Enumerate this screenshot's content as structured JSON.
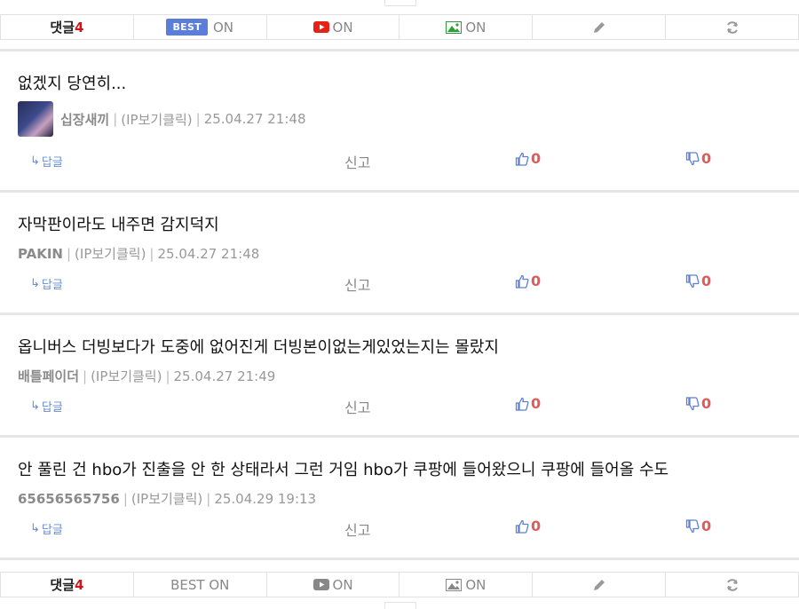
{
  "toolbar": {
    "comments_label": "댓글",
    "comments_count": "4",
    "best_badge": "BEST",
    "best_state": "ON",
    "youtube_state": "ON",
    "image_state": "ON",
    "icons": {
      "youtube": "youtube-icon",
      "image": "image-icon",
      "write": "pencil-icon",
      "refresh": "refresh-icon"
    },
    "colors": {
      "count": "#d0151a",
      "best_badge": "#5b7fd8",
      "youtube": "#e62117",
      "image": "#2e9e3a"
    }
  },
  "bottom_toolbar": {
    "comments_label": "댓글",
    "comments_count": "4",
    "best_text": "BEST ON",
    "youtube_state": "ON",
    "image_state": "ON"
  },
  "comments": [
    {
      "text": "없겠지 당연히...",
      "nick": "십장새끼",
      "ip": "(IP보기클릭)",
      "date": "25.04.27 21:48",
      "has_avatar": true,
      "reply": "답글",
      "report": "신고",
      "likes": "0",
      "dislikes": "0"
    },
    {
      "text": "자막판이라도 내주면 감지덕지",
      "nick": "PAKIN",
      "ip": "(IP보기클릭)",
      "date": "25.04.27 21:48",
      "has_avatar": false,
      "reply": "답글",
      "report": "신고",
      "likes": "0",
      "dislikes": "0"
    },
    {
      "text": "옵니버스 더빙보다가 도중에 없어진게 더빙본이없는게있었는지는 몰랐지",
      "nick": "배틀페이더",
      "ip": "(IP보기클릭)",
      "date": "25.04.27 21:49",
      "has_avatar": false,
      "reply": "답글",
      "report": "신고",
      "likes": "0",
      "dislikes": "0"
    },
    {
      "text": "안 풀린 건 hbo가 진출을 안 한 상태라서 그런 거임 hbo가 쿠팡에 들어왔으니 쿠팡에 들어올 수도",
      "nick": "65656565756",
      "ip": "(IP보기클릭)",
      "date": "25.04.29 19:13",
      "has_avatar": false,
      "reply": "답글",
      "report": "신고",
      "likes": "0",
      "dislikes": "0"
    }
  ]
}
